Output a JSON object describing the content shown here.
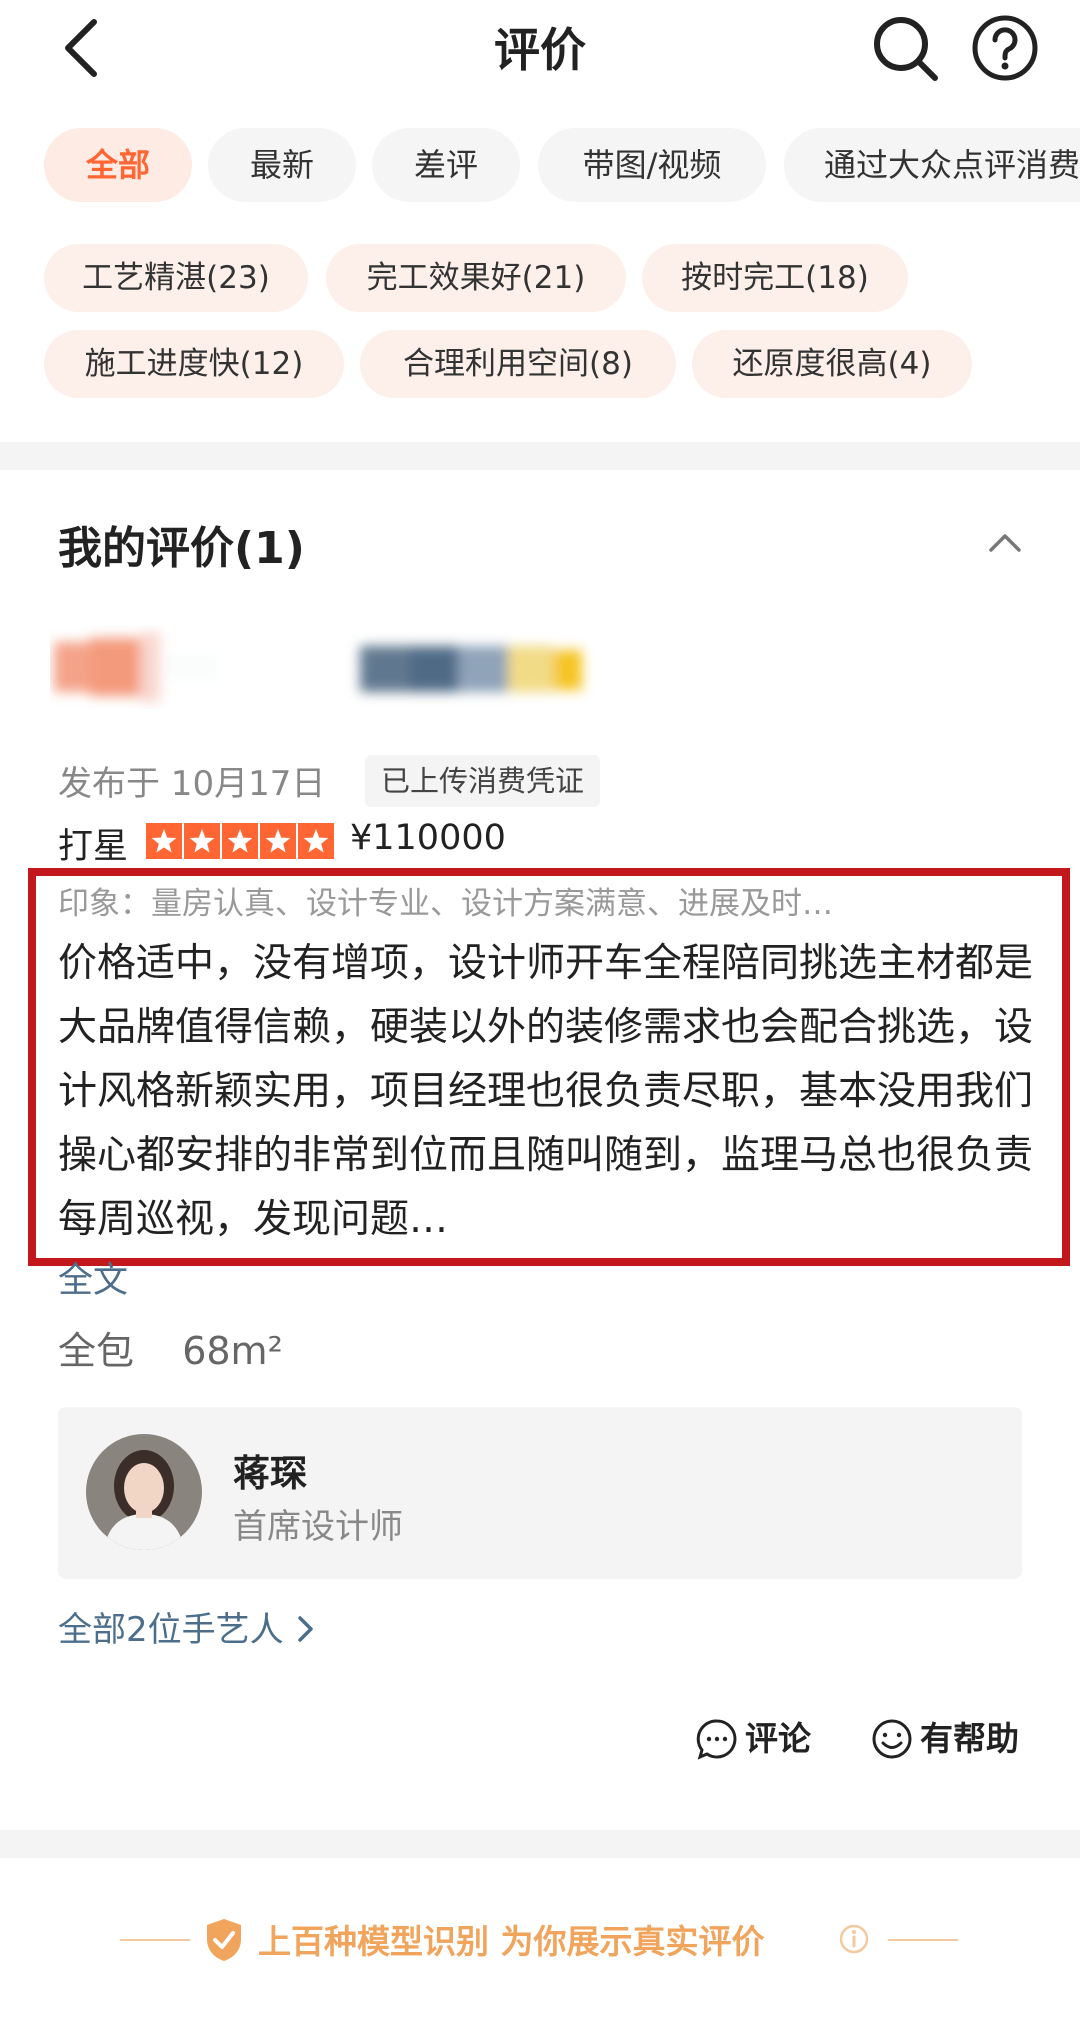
{
  "header": {
    "title": "评价"
  },
  "filters": [
    {
      "label": "全部",
      "active": true
    },
    {
      "label": "最新",
      "active": false
    },
    {
      "label": "差评",
      "active": false
    },
    {
      "label": "带图/视频",
      "active": false
    },
    {
      "label": "通过大众点评消费",
      "active": false
    }
  ],
  "tags": [
    {
      "label": "工艺精湛(23)"
    },
    {
      "label": "完工效果好(21)"
    },
    {
      "label": "按时完工(18)"
    },
    {
      "label": "施工进度快(12)"
    },
    {
      "label": "合理利用空间(8)"
    },
    {
      "label": "还原度很高(4)"
    }
  ],
  "review_section": {
    "title": "我的评价(1)",
    "publish_date": "发布于 10月17日",
    "proof_badge": "已上传消费凭证",
    "rating_label": "打星",
    "stars": 5,
    "price": "¥110000",
    "impression": "印象：量房认真、设计专业、设计方案满意、进展及时…",
    "review_text": "价格适中，没有增项，设计师开车全程陪同挑选主材都是大品牌值得信赖，硬装以外的装修需求也会配合挑选，设计风格新颖实用，项目经理也很负责尽职，基本没用我们操心都安排的非常到位而且随叫随到，监理马总也很负责每周巡视，发现问题…",
    "full_text_link": "全文",
    "package_type": "全包",
    "area": "68m²",
    "designer": {
      "name": "蒋琛",
      "title": "首席设计师"
    },
    "all_craftsmen_link": "全部2位手艺人",
    "comment_label": "评论",
    "helpful_label": "有帮助"
  },
  "trust_banner": {
    "text": "上百种模型识别 为你展示真实评价"
  },
  "colors": {
    "accent": "#ff6633",
    "highlight_border": "#c2181b",
    "link": "#4d6e8a",
    "trust": "#f0a45c"
  }
}
